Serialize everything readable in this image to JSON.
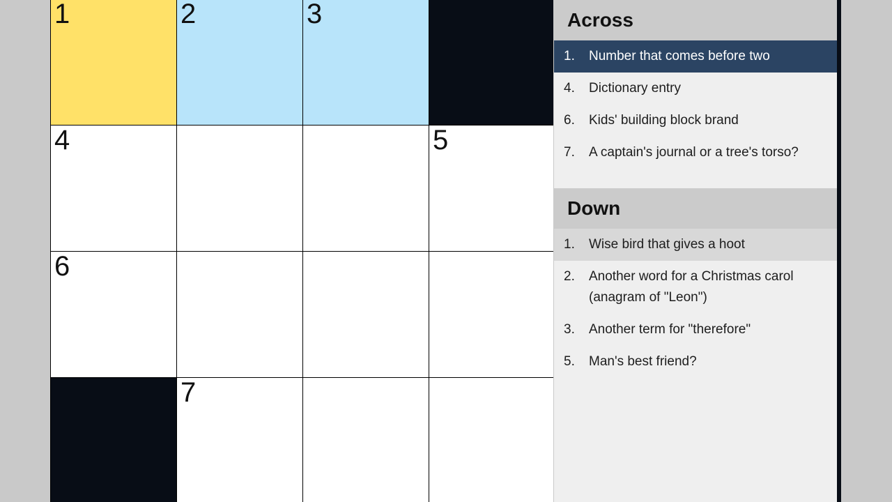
{
  "puzzle": {
    "rows": 4,
    "cols": 4,
    "colors": {
      "block": "#080d16",
      "empty": "#ffffff",
      "active_cell": "#ffe168",
      "word_highlight": "#b8e4fa",
      "grid_line": "#000000",
      "page_background": "#c9c9c9"
    },
    "cells": [
      [
        {
          "num": "1",
          "state": "active",
          "letter": ""
        },
        {
          "num": "2",
          "state": "word",
          "letter": ""
        },
        {
          "num": "3",
          "state": "word",
          "letter": ""
        },
        {
          "num": "",
          "state": "block",
          "letter": ""
        }
      ],
      [
        {
          "num": "4",
          "state": "empty",
          "letter": ""
        },
        {
          "num": "",
          "state": "empty",
          "letter": ""
        },
        {
          "num": "",
          "state": "empty",
          "letter": ""
        },
        {
          "num": "5",
          "state": "empty",
          "letter": ""
        }
      ],
      [
        {
          "num": "6",
          "state": "empty",
          "letter": ""
        },
        {
          "num": "",
          "state": "empty",
          "letter": ""
        },
        {
          "num": "",
          "state": "empty",
          "letter": ""
        },
        {
          "num": "",
          "state": "empty",
          "letter": ""
        }
      ],
      [
        {
          "num": "",
          "state": "block",
          "letter": ""
        },
        {
          "num": "7",
          "state": "empty",
          "letter": ""
        },
        {
          "num": "",
          "state": "empty",
          "letter": ""
        },
        {
          "num": "",
          "state": "empty",
          "letter": ""
        }
      ]
    ]
  },
  "clue_panel": {
    "colors": {
      "panel_background": "#efefef",
      "header_background": "#cbcbcb",
      "selected_primary": "#2b4463",
      "selected_secondary": "#d8d8d8",
      "border": "#080d16"
    },
    "across": {
      "header": "Across",
      "clues": [
        {
          "number": "1.",
          "text": "Number that comes before two",
          "selected": "primary"
        },
        {
          "number": "4.",
          "text": "Dictionary entry",
          "selected": "none"
        },
        {
          "number": "6.",
          "text": "Kids' building block brand",
          "selected": "none"
        },
        {
          "number": "7.",
          "text": "A captain's journal or a tree's torso?",
          "selected": "none"
        }
      ]
    },
    "down": {
      "header": "Down",
      "clues": [
        {
          "number": "1.",
          "text": "Wise bird that gives a hoot",
          "selected": "secondary"
        },
        {
          "number": "2.",
          "text": "Another word for a Christmas carol (anagram of \"Leon\")",
          "selected": "none"
        },
        {
          "number": "3.",
          "text": "Another term for \"therefore\"",
          "selected": "none"
        },
        {
          "number": "5.",
          "text": "Man's best friend?",
          "selected": "none"
        }
      ]
    }
  }
}
